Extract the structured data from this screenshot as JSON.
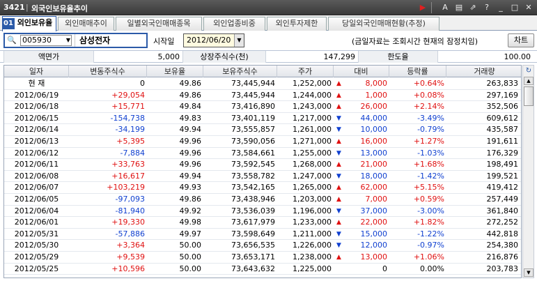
{
  "window": {
    "code": "3421",
    "title": "외국인보유율추이"
  },
  "icons": {
    "title_bar": [
      "play-icon",
      "font-icon",
      "print-icon",
      "export-icon",
      "help-icon",
      "minimize-icon",
      "maximize-icon",
      "close-icon"
    ]
  },
  "tabs": [
    {
      "label": "외인보유율",
      "badge": "01",
      "active": true
    },
    {
      "label": "외인매매추이",
      "active": false
    },
    {
      "label": "일별외국인매매종목",
      "active": false
    },
    {
      "label": "외인업종비중",
      "active": false
    },
    {
      "label": "외인투자제한",
      "active": false
    },
    {
      "label": "당일외국인매매현황(추정)",
      "active": false
    }
  ],
  "controls": {
    "stock_code": "005930",
    "stock_name": "삼성전자",
    "start_label": "시작일",
    "start_date": "2012/06/20",
    "note": "(금일자료는 조회시간 현재의 잠정치임)",
    "chart_button": "차트"
  },
  "info": {
    "par_label": "액면가",
    "par_value": "5,000",
    "listed_label": "상장주식수(천)",
    "listed_value": "147,299",
    "limit_label": "한도율",
    "limit_value": "100.00"
  },
  "table": {
    "headers": [
      "일자",
      "변동주식수",
      "보유율",
      "보유주식수",
      "주가",
      "대비",
      "등락률",
      "거래량"
    ],
    "rows": [
      {
        "date": "현    재",
        "change": "0",
        "ratio": "49.86",
        "held": "73,445,944",
        "price": "1,252,000",
        "dir": "up",
        "diff": "8,000",
        "rate": "+0.64%",
        "volume": "263,833"
      },
      {
        "date": "2012/06/19",
        "change": "+29,054",
        "ratio": "49.86",
        "held": "73,445,944",
        "price": "1,244,000",
        "dir": "up",
        "diff": "1,000",
        "rate": "+0.08%",
        "volume": "297,169"
      },
      {
        "date": "2012/06/18",
        "change": "+15,771",
        "ratio": "49.84",
        "held": "73,416,890",
        "price": "1,243,000",
        "dir": "up",
        "diff": "26,000",
        "rate": "+2.14%",
        "volume": "352,506"
      },
      {
        "date": "2012/06/15",
        "change": "-154,738",
        "ratio": "49.83",
        "held": "73,401,119",
        "price": "1,217,000",
        "dir": "dn",
        "diff": "44,000",
        "rate": "-3.49%",
        "volume": "609,612"
      },
      {
        "date": "2012/06/14",
        "change": "-34,199",
        "ratio": "49.94",
        "held": "73,555,857",
        "price": "1,261,000",
        "dir": "dn",
        "diff": "10,000",
        "rate": "-0.79%",
        "volume": "435,587"
      },
      {
        "date": "2012/06/13",
        "change": "+5,395",
        "ratio": "49.96",
        "held": "73,590,056",
        "price": "1,271,000",
        "dir": "up",
        "diff": "16,000",
        "rate": "+1.27%",
        "volume": "191,611"
      },
      {
        "date": "2012/06/12",
        "change": "-7,884",
        "ratio": "49.96",
        "held": "73,584,661",
        "price": "1,255,000",
        "dir": "dn",
        "diff": "13,000",
        "rate": "-1.03%",
        "volume": "176,329"
      },
      {
        "date": "2012/06/11",
        "change": "+33,763",
        "ratio": "49.96",
        "held": "73,592,545",
        "price": "1,268,000",
        "dir": "up",
        "diff": "21,000",
        "rate": "+1.68%",
        "volume": "198,491"
      },
      {
        "date": "2012/06/08",
        "change": "+16,617",
        "ratio": "49.94",
        "held": "73,558,782",
        "price": "1,247,000",
        "dir": "dn",
        "diff": "18,000",
        "rate": "-1.42%",
        "volume": "199,521"
      },
      {
        "date": "2012/06/07",
        "change": "+103,219",
        "ratio": "49.93",
        "held": "73,542,165",
        "price": "1,265,000",
        "dir": "up",
        "diff": "62,000",
        "rate": "+5.15%",
        "volume": "419,412"
      },
      {
        "date": "2012/06/05",
        "change": "-97,093",
        "ratio": "49.86",
        "held": "73,438,946",
        "price": "1,203,000",
        "dir": "up",
        "diff": "7,000",
        "rate": "+0.59%",
        "volume": "257,449"
      },
      {
        "date": "2012/06/04",
        "change": "-81,940",
        "ratio": "49.92",
        "held": "73,536,039",
        "price": "1,196,000",
        "dir": "dn",
        "diff": "37,000",
        "rate": "-3.00%",
        "volume": "361,840"
      },
      {
        "date": "2012/06/01",
        "change": "+19,330",
        "ratio": "49.98",
        "held": "73,617,979",
        "price": "1,233,000",
        "dir": "up",
        "diff": "22,000",
        "rate": "+1.82%",
        "volume": "272,252"
      },
      {
        "date": "2012/05/31",
        "change": "-57,886",
        "ratio": "49.97",
        "held": "73,598,649",
        "price": "1,211,000",
        "dir": "dn",
        "diff": "15,000",
        "rate": "-1.22%",
        "volume": "442,818"
      },
      {
        "date": "2012/05/30",
        "change": "+3,364",
        "ratio": "50.00",
        "held": "73,656,535",
        "price": "1,226,000",
        "dir": "dn",
        "diff": "12,000",
        "rate": "-0.97%",
        "volume": "254,380"
      },
      {
        "date": "2012/05/29",
        "change": "+9,539",
        "ratio": "50.00",
        "held": "73,653,171",
        "price": "1,238,000",
        "dir": "up",
        "diff": "13,000",
        "rate": "+1.06%",
        "volume": "216,876"
      },
      {
        "date": "2012/05/25",
        "change": "+10,596",
        "ratio": "50.00",
        "held": "73,643,632",
        "price": "1,225,000",
        "dir": "none",
        "diff": "0",
        "rate": "0.00%",
        "volume": "203,783"
      }
    ]
  },
  "colors": {
    "up": "#e01010",
    "down": "#1040d0",
    "accent": "#2b5aa8"
  }
}
